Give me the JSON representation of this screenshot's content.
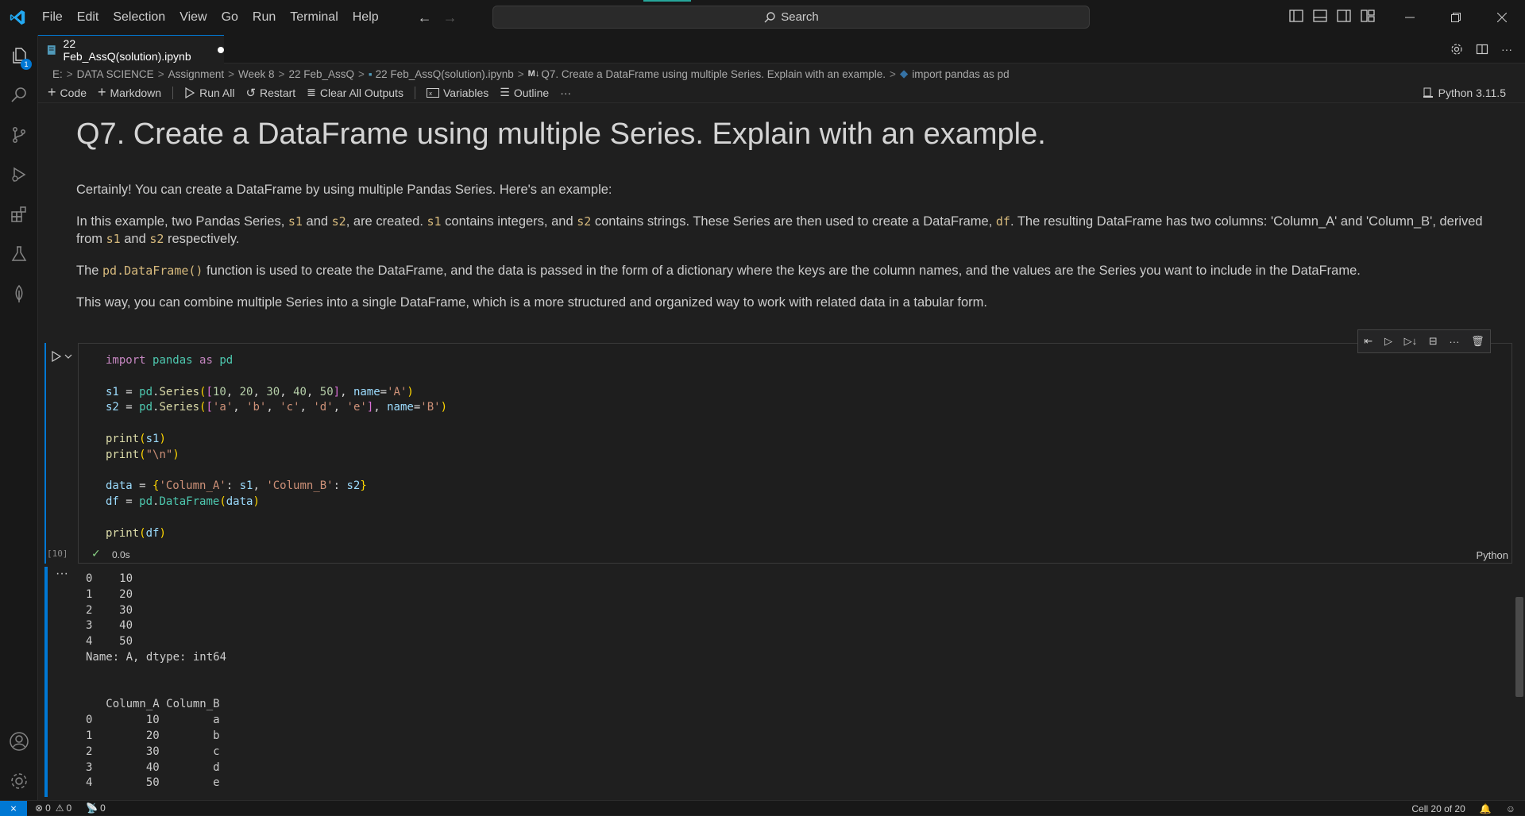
{
  "menu": [
    "File",
    "Edit",
    "Selection",
    "View",
    "Go",
    "Run",
    "Terminal",
    "Help"
  ],
  "search": {
    "label": "Search"
  },
  "tab": {
    "title": "22 Feb_AssQ(solution).ipynb"
  },
  "explorer_badge": "1",
  "breadcrumb": [
    "E:",
    "DATA SCIENCE",
    "Assignment",
    "Week 8",
    "22 Feb_AssQ",
    "22 Feb_AssQ(solution).ipynb",
    "Q7. Create a DataFrame using multiple Series. Explain with an example.",
    "import pandas as pd"
  ],
  "toolbar": {
    "code": "Code",
    "markdown": "Markdown",
    "run_all": "Run All",
    "restart": "Restart",
    "clear_outputs": "Clear All Outputs",
    "variables": "Variables",
    "outline": "Outline",
    "more": "···",
    "kernel": "Python 3.11.5"
  },
  "markdown": {
    "heading": "Q7. Create a DataFrame using multiple Series. Explain with an example.",
    "p1": "Certainly! You can create a DataFrame by using multiple Pandas Series. Here's an example:",
    "p2_a": "In this example, two Pandas Series, ",
    "p2_s1": "s1",
    "p2_b": " and ",
    "p2_s2": "s2",
    "p2_c": ", are created. ",
    "p2_d": " contains integers, and ",
    "p2_e": " contains strings. These Series are then used to create a DataFrame, ",
    "p2_df": "df",
    "p2_f": ". The resulting DataFrame has two columns: 'Column_A' and 'Column_B', derived from ",
    "p2_g": " respectively.",
    "p3_a": "The ",
    "p3_code": "pd.DataFrame()",
    "p3_b": " function is used to create the DataFrame, and the data is passed in the form of a dictionary where the keys are the column names, and the values are the Series you want to include in the DataFrame.",
    "p4": "This way, you can combine multiple Series into a single DataFrame, which is a more structured and organized way to work with related data in a tabular form."
  },
  "cell": {
    "exec_count": "[10]",
    "exec_time": "0.0s",
    "language": "Python"
  },
  "output": {
    "more": "···",
    "text": "0    10\n1    20\n2    30\n3    40\n4    50\nName: A, dtype: int64\n\n\n   Column_A Column_B\n0        10        a\n1        20        b\n2        30        c\n3        40        d\n4        50        e"
  },
  "status": {
    "errors": "0",
    "warnings": "0",
    "ports": "0",
    "cell_position": "Cell 20 of 20"
  },
  "colors": {
    "accent": "#0078d4",
    "background": "#1f1f1f"
  }
}
